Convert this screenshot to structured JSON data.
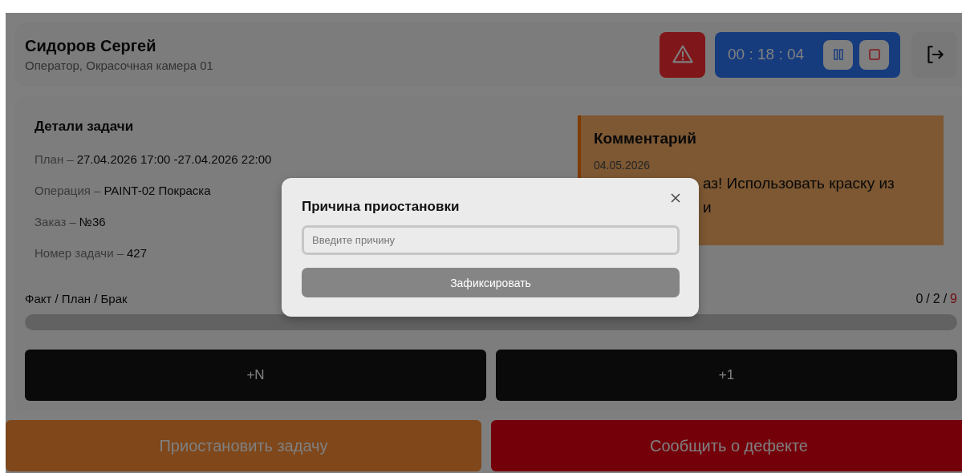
{
  "header": {
    "name": "Сидоров Сергей",
    "role": "Оператор, Окрасочная камера 01",
    "timer": "00 : 18 : 04"
  },
  "details": {
    "title": "Детали задачи",
    "rows": [
      {
        "label": "План –",
        "value": "27.04.2026 17:00 -27.04.2026 22:00"
      },
      {
        "label": "Операция –",
        "value": "PAINT-02 Покраска"
      },
      {
        "label": "Заказ –",
        "value": "№36"
      },
      {
        "label": "Номер задачи –",
        "value": "427"
      }
    ]
  },
  "comment": {
    "title": "Комментарий",
    "date": "04.05.2026",
    "lines": [
      "аз! Использовать краску из",
      "и"
    ]
  },
  "progress": {
    "label": "Факт / План / Брак",
    "fact": "0",
    "separator_1": "/",
    "plan": "2",
    "separator_2": "/",
    "defect": "9"
  },
  "counter_buttons": [
    "+N",
    "+1"
  ],
  "actions": [
    {
      "label": "Приостановить задачу",
      "kind": "pause"
    },
    {
      "label": "Сообщить о дефекте",
      "kind": "defect"
    }
  ],
  "modal": {
    "title": "Причина приостановки",
    "placeholder": "Введите причину",
    "button": "Зафиксировать"
  }
}
